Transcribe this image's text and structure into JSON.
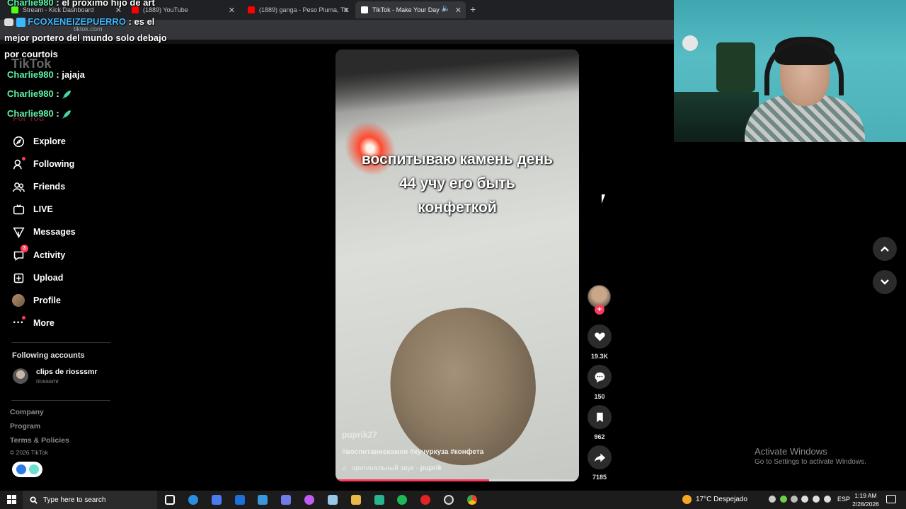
{
  "browser": {
    "tabs": [
      {
        "label": "Stream - Kick Dashboard",
        "color": "#53fc18"
      },
      {
        "label": "(1889) YouTube",
        "color": "#ff0000"
      },
      {
        "label": "(1889) ganga - Peso Pluma, Tit",
        "color": "#ff0000"
      },
      {
        "label": "TikTok - Make Your Day",
        "color": "#ffffff"
      }
    ],
    "url": "tiktok.com"
  },
  "chat": [
    {
      "user": "Charlie980",
      "text": ": el proximo hijo de art"
    },
    {
      "user": "FCOXENEIZEPUERRO",
      "text": ": es el mejor portero del mundo solo debajo por courtois"
    },
    {
      "user": "Charlie980",
      "text": ": jajaja"
    },
    {
      "user": "Charlie980",
      "text": ":"
    },
    {
      "user": "Charlie980",
      "text": ":"
    }
  ],
  "sidebar": {
    "logo": "TikTok",
    "for_you": "For You",
    "items": [
      {
        "label": "Explore",
        "icon": "compass-icon"
      },
      {
        "label": "Following",
        "icon": "following-icon"
      },
      {
        "label": "Friends",
        "icon": "friends-icon"
      },
      {
        "label": "LIVE",
        "icon": "live-icon"
      },
      {
        "label": "Messages",
        "icon": "messages-icon"
      },
      {
        "label": "Activity",
        "icon": "activity-icon",
        "badge": "3"
      },
      {
        "label": "Upload",
        "icon": "upload-icon"
      },
      {
        "label": "Profile",
        "icon": "profile-avatar"
      },
      {
        "label": "More",
        "icon": "more-icon"
      }
    ],
    "following_title": "Following accounts",
    "following": [
      {
        "name": "clips de riosssmr",
        "handle": "riosssmr"
      }
    ],
    "footer": [
      "Company",
      "Program",
      "Terms & Policies"
    ],
    "copyright": "© 2026 TikTok"
  },
  "video": {
    "caption_lines": [
      "воспитываю камень день",
      "44 учу его быть",
      "конфеткой"
    ],
    "username": "puprik27",
    "hashtags": "#воспитаниекамня #кучуркуза #конфета",
    "sound_label": "оригинальный звук - ",
    "sound_author": "puprik",
    "progress": 0.63
  },
  "actions": {
    "likes": "19.3K",
    "comments": "150",
    "saves": "962",
    "shares": "7185"
  },
  "watermark": {
    "title": "Activate Windows",
    "subtitle": "Go to Settings to activate Windows."
  },
  "taskbar": {
    "search_placeholder": "Type here to search",
    "weather": "17°C  Despejado",
    "lang": "ESP",
    "time": "1:19 AM",
    "date": "2/28/2026"
  }
}
